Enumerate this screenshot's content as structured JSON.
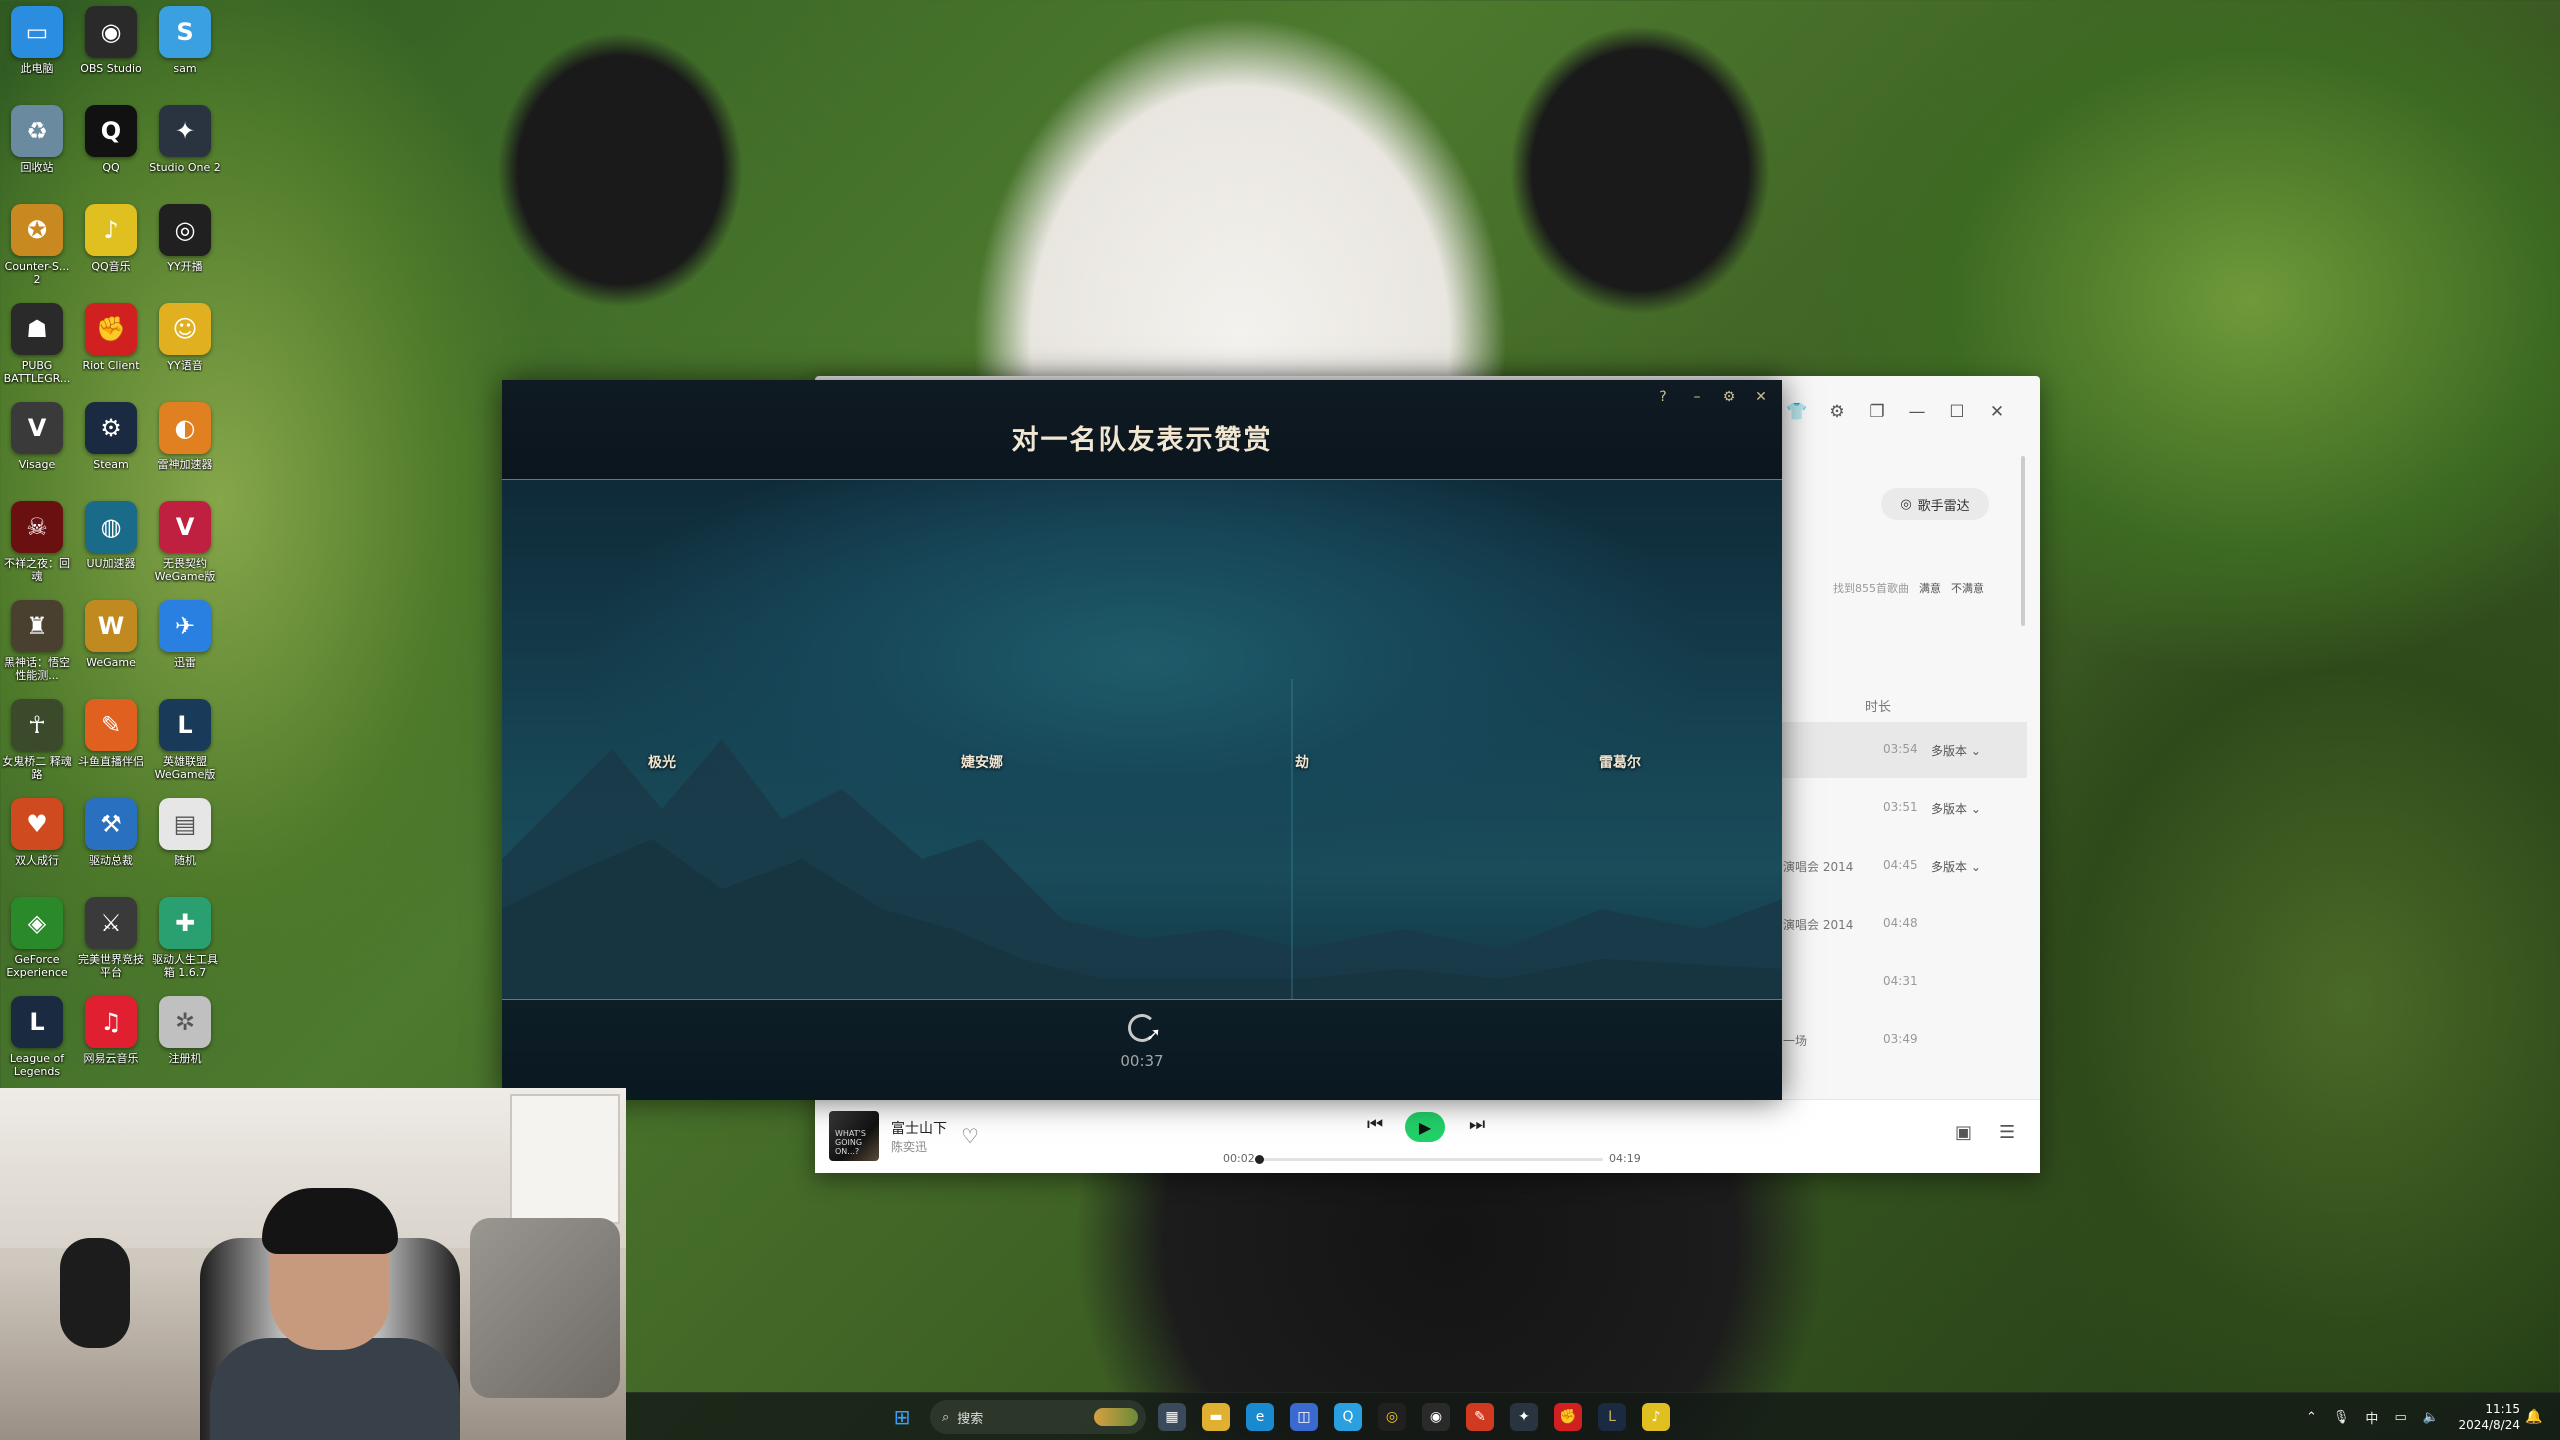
{
  "desktop": {
    "icons": [
      {
        "label": "此电脑",
        "color": "#2a8de0",
        "glyph": "▭"
      },
      {
        "label": "OBS Studio",
        "color": "#2a2a2a",
        "glyph": "◉"
      },
      {
        "label": "sam",
        "color": "#3aa0e0",
        "glyph": "S"
      },
      {
        "label": "回收站",
        "color": "#6a8aa0",
        "glyph": "♻"
      },
      {
        "label": "QQ",
        "color": "#111111",
        "glyph": "Q"
      },
      {
        "label": "Studio One 2",
        "color": "#2a3440",
        "glyph": "✦"
      },
      {
        "label": "Counter-S... 2",
        "color": "#c88a20",
        "glyph": "✪"
      },
      {
        "label": "QQ音乐",
        "color": "#e0c020",
        "glyph": "♪"
      },
      {
        "label": "YY开播",
        "color": "#202020",
        "glyph": "◎"
      },
      {
        "label": "PUBG BATTLEGR...",
        "color": "#2a2a2a",
        "glyph": "☗"
      },
      {
        "label": "Riot Client",
        "color": "#d02020",
        "glyph": "✊"
      },
      {
        "label": "YY语音",
        "color": "#e0b020",
        "glyph": "☺"
      },
      {
        "label": "Visage",
        "color": "#3a3a3a",
        "glyph": "V"
      },
      {
        "label": "Steam",
        "color": "#1a2a40",
        "glyph": "⚙"
      },
      {
        "label": "雷神加速器",
        "color": "#e08020",
        "glyph": "◐"
      },
      {
        "label": "不祥之夜：回魂",
        "color": "#6a1010",
        "glyph": "☠"
      },
      {
        "label": "UU加速器",
        "color": "#1a6a8a",
        "glyph": "◍"
      },
      {
        "label": "无畏契约 WeGame版",
        "color": "#c02040",
        "glyph": "V"
      },
      {
        "label": "黑神话：悟空性能测...",
        "color": "#4a4030",
        "glyph": "♜"
      },
      {
        "label": "WeGame",
        "color": "#c08a20",
        "glyph": "W"
      },
      {
        "label": "迅雷",
        "color": "#2a80e0",
        "glyph": "✈"
      },
      {
        "label": "女鬼桥二 释魂路",
        "color": "#3a4a2a",
        "glyph": "☥"
      },
      {
        "label": "斗鱼直播伴侣",
        "color": "#e06020",
        "glyph": "✎"
      },
      {
        "label": "英雄联盟 WeGame版",
        "color": "#1a3a5a",
        "glyph": "L"
      },
      {
        "label": "双人成行",
        "color": "#d04a20",
        "glyph": "♥"
      },
      {
        "label": "驱动总裁",
        "color": "#2a70c0",
        "glyph": "⚒"
      },
      {
        "label": "随机",
        "color": "#e6e6e6",
        "glyph": "▤"
      },
      {
        "label": "GeForce Experience",
        "color": "#2a8a2a",
        "glyph": "◈"
      },
      {
        "label": "完美世界竞技平台",
        "color": "#3a3a3a",
        "glyph": "⚔"
      },
      {
        "label": "驱动人生工具箱 1.6.7",
        "color": "#2aa070",
        "glyph": "✚"
      },
      {
        "label": "League of Legends",
        "color": "#1a2a40",
        "glyph": "L"
      },
      {
        "label": "网易云音乐",
        "color": "#e02030",
        "glyph": "♫"
      },
      {
        "label": "注册机",
        "color": "#c0c0c0",
        "glyph": "✲"
      }
    ]
  },
  "music": {
    "singer_radar": "歌手雷达",
    "feedback": {
      "found": "找到855首歌曲",
      "satisfied": "满意",
      "unsatisfied": "不满意"
    },
    "col_duration": "时长",
    "rows": [
      {
        "album": "",
        "duration": "03:54",
        "version": "多版本",
        "selected": true
      },
      {
        "album": "",
        "duration": "03:51",
        "version": "多版本",
        "selected": false
      },
      {
        "album": "演唱会 2014",
        "duration": "04:45",
        "version": "多版本",
        "selected": false
      },
      {
        "album": "演唱会 2014",
        "duration": "04:48",
        "version": "",
        "selected": false
      },
      {
        "album": "",
        "duration": "04:31",
        "version": "",
        "selected": false
      },
      {
        "album": "一场",
        "duration": "03:49",
        "version": "",
        "selected": false
      }
    ],
    "player": {
      "title": "富士山下",
      "artist": "陈奕迅",
      "current_time": "00:02",
      "total_time": "04:19",
      "progress": 0.008,
      "cover_text": "WHAT'S GOING ON...?"
    }
  },
  "lol": {
    "title": "对一名队友表示赞赏",
    "players": [
      "极光",
      "婕安娜",
      "劫",
      "雷葛尔"
    ],
    "timer": "00:37",
    "buttons": {
      "help": "?",
      "minimize": "–",
      "settings": "⚙",
      "close": "✕"
    }
  },
  "taskbar": {
    "search_placeholder": "搜索",
    "ime": "中",
    "time": "11:15",
    "date": "2024/8/24"
  }
}
